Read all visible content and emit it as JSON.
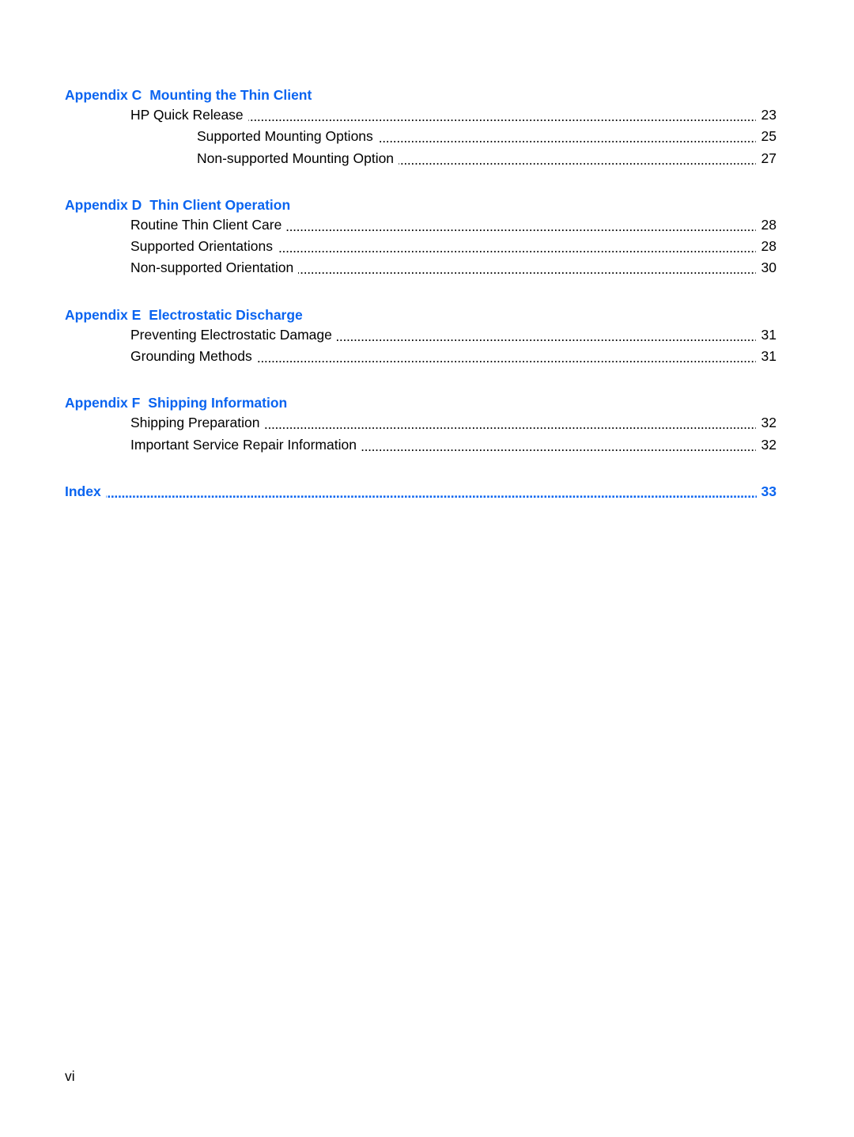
{
  "toc": {
    "sections": [
      {
        "number": "Appendix C",
        "title": "Mounting the Thin Client",
        "entries": [
          {
            "label": "HP Quick Release",
            "page": "23",
            "level": 2
          },
          {
            "label": "Supported Mounting Options",
            "page": "25",
            "level": 3
          },
          {
            "label": "Non-supported Mounting Option",
            "page": "27",
            "level": 3
          }
        ]
      },
      {
        "number": "Appendix D",
        "title": "Thin Client Operation",
        "entries": [
          {
            "label": "Routine Thin Client Care",
            "page": "28",
            "level": 2
          },
          {
            "label": "Supported Orientations",
            "page": "28",
            "level": 2
          },
          {
            "label": "Non-supported Orientation",
            "page": "30",
            "level": 2
          }
        ]
      },
      {
        "number": "Appendix E",
        "title": "Electrostatic Discharge",
        "entries": [
          {
            "label": "Preventing Electrostatic Damage",
            "page": "31",
            "level": 2
          },
          {
            "label": "Grounding Methods",
            "page": "31",
            "level": 2
          }
        ]
      },
      {
        "number": "Appendix F",
        "title": "Shipping Information",
        "entries": [
          {
            "label": "Shipping Preparation",
            "page": "32",
            "level": 2
          },
          {
            "label": "Important Service Repair Information",
            "page": "32",
            "level": 2
          }
        ]
      }
    ],
    "index": {
      "label": "Index",
      "page": "33"
    }
  },
  "footer": {
    "page_number": "vi"
  },
  "colors": {
    "link": "#0a64f0",
    "text": "#000000"
  }
}
